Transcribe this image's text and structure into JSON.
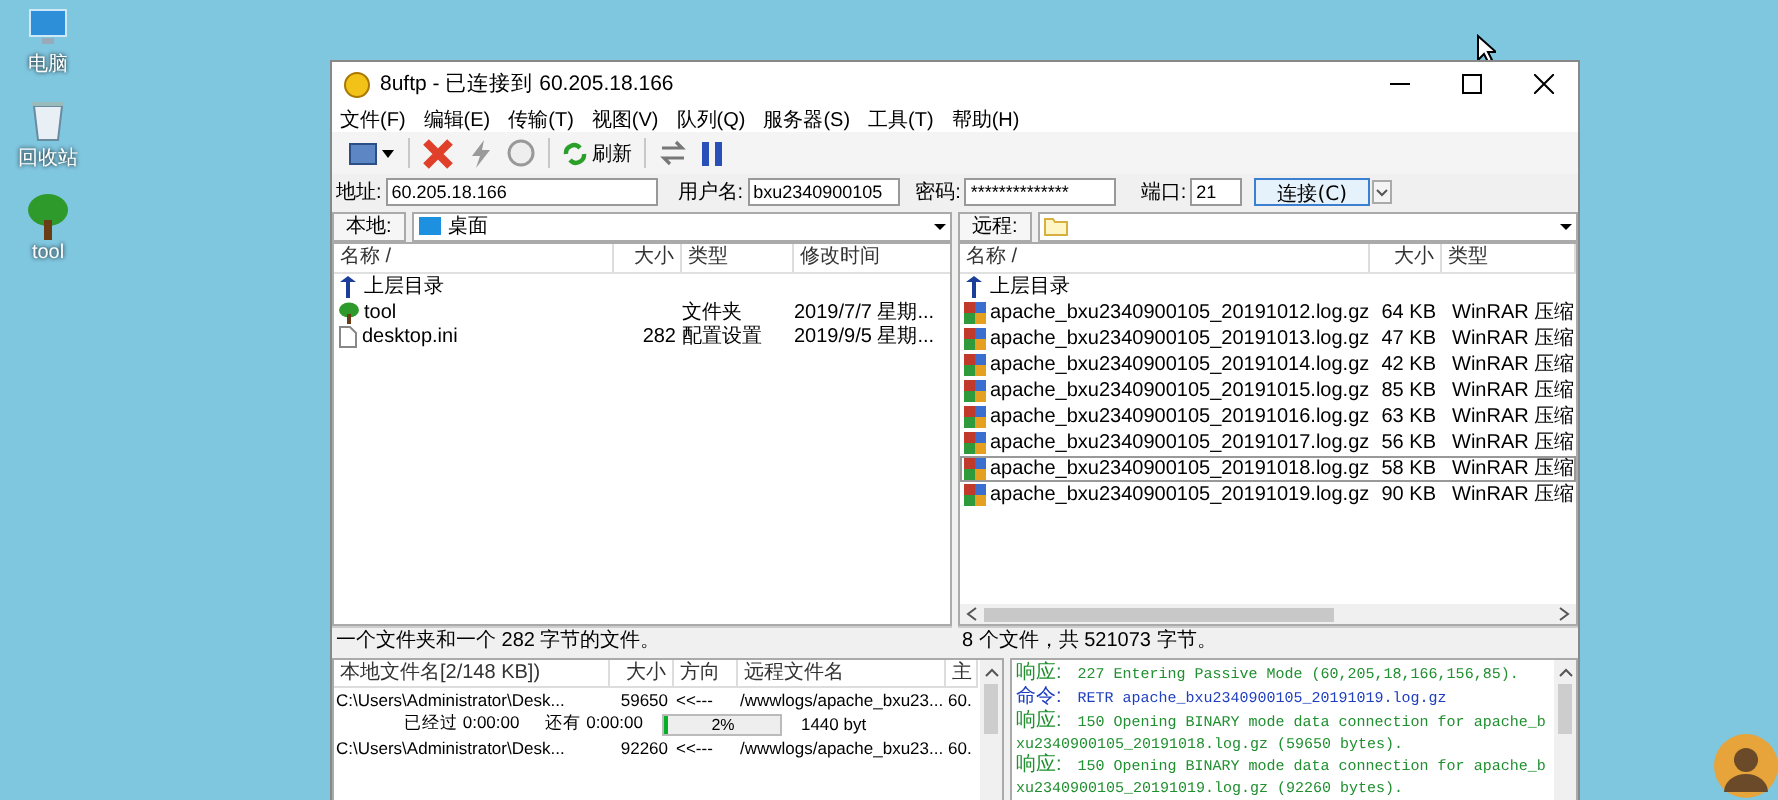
{
  "desktop_icons": [
    {
      "label": "电脑",
      "kind": "computer"
    },
    {
      "label": "回收站",
      "kind": "recycle"
    },
    {
      "label": "tool",
      "kind": "tree"
    }
  ],
  "window": {
    "title": "8uftp - 已连接到 60.205.18.166"
  },
  "menu": [
    "文件(F)",
    "编辑(E)",
    "传输(T)",
    "视图(V)",
    "队列(Q)",
    "服务器(S)",
    "工具(T)",
    "帮助(H)"
  ],
  "toolbar": {
    "refresh_label": "刷新"
  },
  "connection": {
    "address_label": "地址:",
    "address": "60.205.18.166",
    "user_label": "用户名:",
    "user": "bxu2340900105",
    "password_label": "密码:",
    "password": "**************",
    "port_label": "端口:",
    "port": "21",
    "connect_button": "连接(C)"
  },
  "local": {
    "path_label": "本地:",
    "path": "桌面",
    "columns": [
      "名称 /",
      "大小",
      "类型",
      "修改时间"
    ],
    "rows": [
      {
        "kind": "up",
        "name": "上层目录"
      },
      {
        "kind": "folder",
        "name": "tool",
        "type": "文件夹",
        "modified": "2019/7/7 星期..."
      },
      {
        "kind": "file",
        "name": "desktop.ini",
        "size": "282",
        "type": "配置设置",
        "modified": "2019/9/5 星期..."
      }
    ],
    "status": "一个文件夹和一个 282 字节的文件。"
  },
  "remote": {
    "path_label": "远程:",
    "columns": [
      "名称 /",
      "大小",
      "类型"
    ],
    "rows": [
      {
        "kind": "up",
        "name": "上层目录",
        "selected": false
      },
      {
        "kind": "archive",
        "name": "apache_bxu2340900105_20191012.log.gz",
        "size": "64 KB",
        "type": "WinRAR 压缩",
        "selected": false
      },
      {
        "kind": "archive",
        "name": "apache_bxu2340900105_20191013.log.gz",
        "size": "47 KB",
        "type": "WinRAR 压缩",
        "selected": false
      },
      {
        "kind": "archive",
        "name": "apache_bxu2340900105_20191014.log.gz",
        "size": "42 KB",
        "type": "WinRAR 压缩",
        "selected": false
      },
      {
        "kind": "archive",
        "name": "apache_bxu2340900105_20191015.log.gz",
        "size": "85 KB",
        "type": "WinRAR 压缩",
        "selected": false
      },
      {
        "kind": "archive",
        "name": "apache_bxu2340900105_20191016.log.gz",
        "size": "63 KB",
        "type": "WinRAR 压缩",
        "selected": false
      },
      {
        "kind": "archive",
        "name": "apache_bxu2340900105_20191017.log.gz",
        "size": "56 KB",
        "type": "WinRAR 压缩",
        "selected": false
      },
      {
        "kind": "archive",
        "name": "apache_bxu2340900105_20191018.log.gz",
        "size": "58 KB",
        "type": "WinRAR 压缩",
        "selected": true
      },
      {
        "kind": "archive",
        "name": "apache_bxu2340900105_20191019.log.gz",
        "size": "90 KB",
        "type": "WinRAR 压缩",
        "selected": false
      }
    ],
    "status": "8 个文件，共 521073 字节。"
  },
  "queue": {
    "columns": [
      "本地文件名[2/148 KB])",
      "大小",
      "方向",
      "远程文件名",
      "主"
    ],
    "items": [
      {
        "local": "C:\\Users\\Administrator\\Desk...",
        "size": "59650",
        "direction": "<<---",
        "remote": "/wwwlogs/apache_bxu23...",
        "column_5": "60.",
        "elapsed": "已经过 0:00:00",
        "remaining": "还有 0:00:00",
        "level": 0.02,
        "progress_label": "2%",
        "rate": "1440 byt"
      },
      {
        "local": "C:\\Users\\Administrator\\Desk...",
        "size": "92260",
        "direction": "<<---",
        "remote": "/wwwlogs/apache_bxu23...",
        "column_5": "60."
      }
    ]
  },
  "log": [
    {
      "kind": "response",
      "label": "响应:",
      "text": "227 Entering Passive Mode (60,205,18,166,156,85)."
    },
    {
      "kind": "command",
      "label": "命令:",
      "text": "RETR apache_bxu2340900105_20191019.log.gz"
    },
    {
      "kind": "response",
      "label": "响应:",
      "text": "150 Opening BINARY mode data connection for apache_bxu2340900105_20191018.log.gz (59650 bytes)."
    },
    {
      "kind": "response",
      "label": "响应:",
      "text": "150 Opening BINARY mode data connection for apache_bxu2340900105_20191019.log.gz (92260 bytes)."
    }
  ]
}
